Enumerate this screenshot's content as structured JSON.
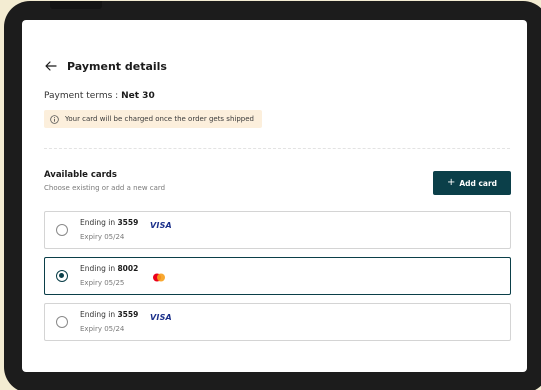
{
  "page": {
    "title": "Payment details",
    "back_icon": "arrow-left-icon"
  },
  "terms": {
    "label": "Payment terms :",
    "value": "Net 30"
  },
  "notice": {
    "icon": "info-icon",
    "text": "Your card will be charged once the order gets shipped",
    "background": "#fcefdc"
  },
  "cards_section": {
    "title": "Available cards",
    "subtitle": "Choose existing or add a new card",
    "add_button": {
      "icon": "plus-icon",
      "label": "Add card"
    }
  },
  "cards": [
    {
      "prefix": "Ending in",
      "last4": "3559",
      "expiry": "Expiry 05/24",
      "brand": "VISA",
      "selected": false
    },
    {
      "prefix": "Ending in",
      "last4": "8002",
      "expiry": "Expiry 05/25",
      "brand": "mastercard",
      "selected": true
    },
    {
      "prefix": "Ending in",
      "last4": "3559",
      "expiry": "Expiry 05/24",
      "brand": "VISA",
      "selected": false
    }
  ],
  "colors": {
    "accent": "#0b3f49",
    "background": "#f3ecd2",
    "device_frame": "#1c1c1c",
    "visa_blue": "#1a2f8a",
    "mastercard_red": "#eb001b",
    "mastercard_orange": "#f79e1b"
  }
}
